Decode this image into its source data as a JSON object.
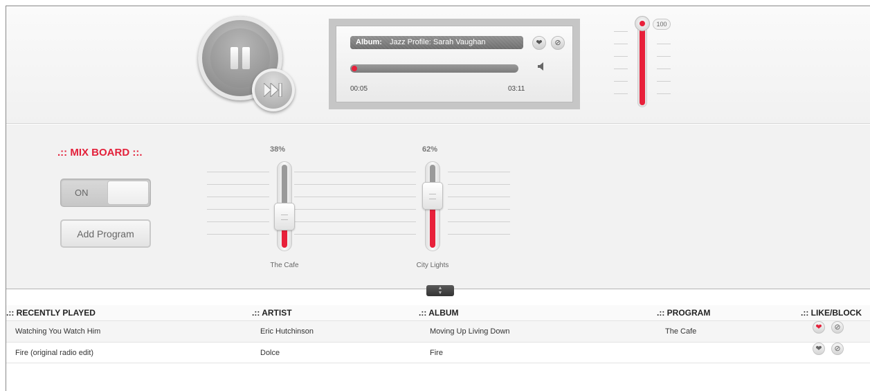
{
  "player": {
    "album_label": "Album:",
    "album_name": "Jazz Profile: Sarah Vaughan",
    "time_elapsed": "00:05",
    "time_total": "03:11",
    "volume": "100",
    "volume_level": 1.0
  },
  "mixboard": {
    "title": ".:: MIX BOARD ::.",
    "toggle_label": "ON",
    "add_program_label": "Add Program",
    "faders": [
      {
        "name": "The Cafe",
        "percent": "38%",
        "level": 0.38
      },
      {
        "name": "City Lights",
        "percent": "62%",
        "level": 0.62
      }
    ]
  },
  "table": {
    "headers": {
      "recent": ".:: RECENTLY PLAYED",
      "artist": ".:: ARTIST",
      "album": ".:: ALBUM",
      "program": ".:: PROGRAM",
      "likeblock": ".:: LIKE/BLOCK"
    },
    "rows": [
      {
        "track": "Watching You Watch Him",
        "artist": "Eric Hutchinson",
        "album": "Moving Up Living Down",
        "program": "The Cafe",
        "liked": true
      },
      {
        "track": "Fire (original radio edit)",
        "artist": "Dolce",
        "album": "Fire",
        "program": "",
        "liked": false
      }
    ]
  },
  "icons": {
    "heart": "heart-icon",
    "block": "block-icon",
    "speaker": "speaker-icon",
    "pause": "pause-icon",
    "skip": "skip-forward-icon"
  },
  "colors": {
    "accent": "#e8203a"
  }
}
